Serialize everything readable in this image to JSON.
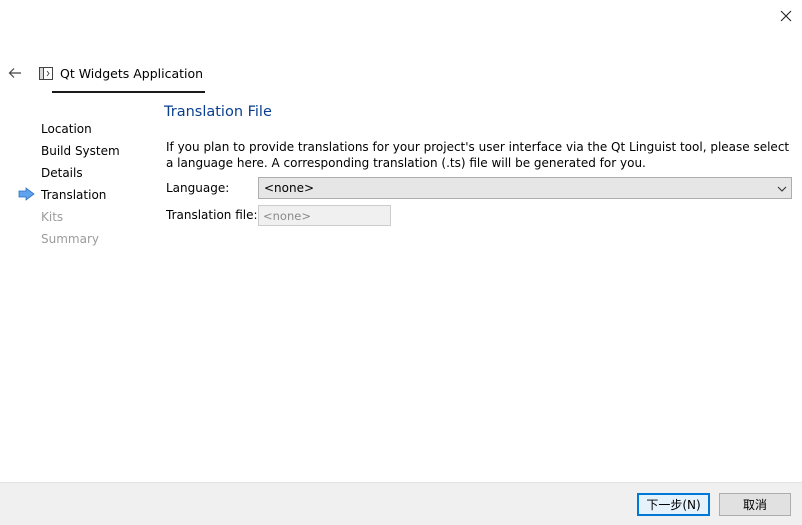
{
  "window": {
    "close_icon": "close-icon",
    "back_icon": "arrow-left-icon"
  },
  "wizard_tab": {
    "title": "Qt Widgets Application",
    "icon": "application-window-icon"
  },
  "steps": [
    {
      "label": "Location",
      "state": "done"
    },
    {
      "label": "Build System",
      "state": "done"
    },
    {
      "label": "Details",
      "state": "done"
    },
    {
      "label": "Translation",
      "state": "current"
    },
    {
      "label": "Kits",
      "state": "pending"
    },
    {
      "label": "Summary",
      "state": "pending"
    }
  ],
  "page": {
    "title": "Translation File",
    "description": "If you plan to provide translations for your project's user interface via the Qt Linguist tool, please select a language here. A corresponding translation (.ts) file will be generated for you.",
    "language_label": "Language:",
    "language_value": "<none>",
    "translation_file_label": "Translation file:",
    "translation_file_value": "<none>"
  },
  "footer": {
    "next_label": "下一步(N)",
    "cancel_label": "取消"
  },
  "colors": {
    "title": "#0a3f8f",
    "disabled_step": "#9b9b9b",
    "current_step_arrow": "#3c8ee6",
    "default_button_border": "#0078d7"
  }
}
